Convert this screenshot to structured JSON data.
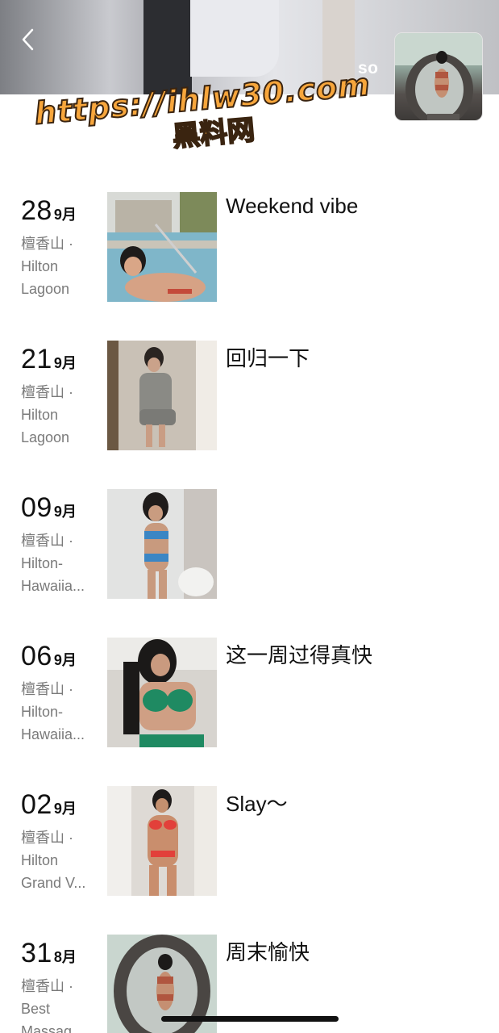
{
  "header": {
    "back_icon": "chevron-left-icon",
    "profile_name": "so"
  },
  "watermark": {
    "line1": "https://ihlw30.com",
    "line2": "黑料网"
  },
  "posts": [
    {
      "day": "28",
      "month": "9月",
      "loc1": "檀香山 ·",
      "loc2": "Hilton",
      "loc3": "Lagoon",
      "caption": "Weekend vibe"
    },
    {
      "day": "21",
      "month": "9月",
      "loc1": "檀香山 ·",
      "loc2": "Hilton",
      "loc3": "Lagoon",
      "caption": "回归一下"
    },
    {
      "day": "09",
      "month": "9月",
      "loc1": "檀香山 ·",
      "loc2": "Hilton-",
      "loc3": "Hawaiia...",
      "caption": ""
    },
    {
      "day": "06",
      "month": "9月",
      "loc1": "檀香山 ·",
      "loc2": "Hilton-",
      "loc3": "Hawaiia...",
      "caption": "这一周过得真快"
    },
    {
      "day": "02",
      "month": "9月",
      "loc1": "檀香山 ·",
      "loc2": "Hilton",
      "loc3": "Grand V...",
      "caption": "Slay～"
    },
    {
      "day": "31",
      "month": "8月",
      "loc1": "檀香山 ·",
      "loc2": "Best",
      "loc3": "Massag...",
      "caption": "周末愉快"
    }
  ],
  "colors": {
    "watermark_fill": "#f7a63c",
    "text_primary": "#111111",
    "text_secondary": "#7a7a7a"
  }
}
